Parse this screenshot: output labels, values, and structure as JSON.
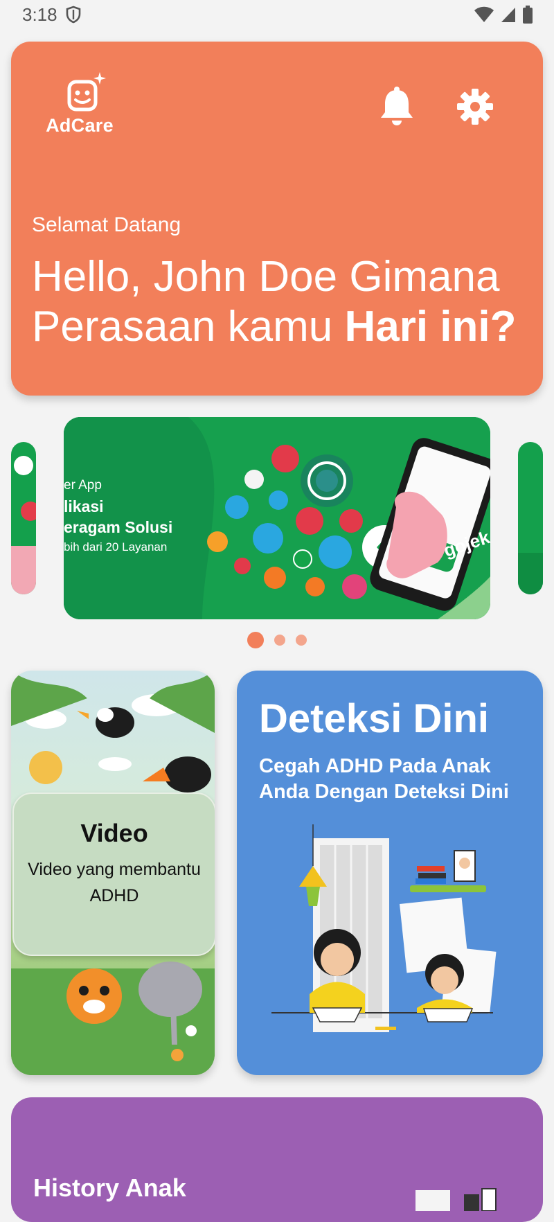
{
  "status_bar": {
    "time": "3:18"
  },
  "hero": {
    "logo_text": "AdCare",
    "welcome": "Selamat Datang",
    "greeting_plain": "Hello, John Doe Gimana Perasaan kamu ",
    "greeting_bold": "Hari ini?"
  },
  "carousel": {
    "slide_line1": "er App",
    "slide_line2": "likasi",
    "slide_line3": "eragam Solusi",
    "slide_line4": "bih dari 20 Layanan",
    "brand": "gojek",
    "active_index": 0,
    "total": 3
  },
  "video_card": {
    "title": "Video",
    "subtitle": "Video yang membantu ADHD"
  },
  "detect_card": {
    "title": "Deteksi Dini",
    "subtitle": "Cegah ADHD Pada Anak Anda Dengan Deteksi Dini"
  },
  "history_card": {
    "title": "History Anak"
  },
  "colors": {
    "hero_bg": "#f27f5a",
    "carousel_green": "#16a04e",
    "detect_bg": "#548fd9",
    "history_bg": "#9c5fb3",
    "video_overlay": "#c6dcc2",
    "dot_active": "#f27f5a",
    "dot_inactive": "#f3a58c"
  }
}
